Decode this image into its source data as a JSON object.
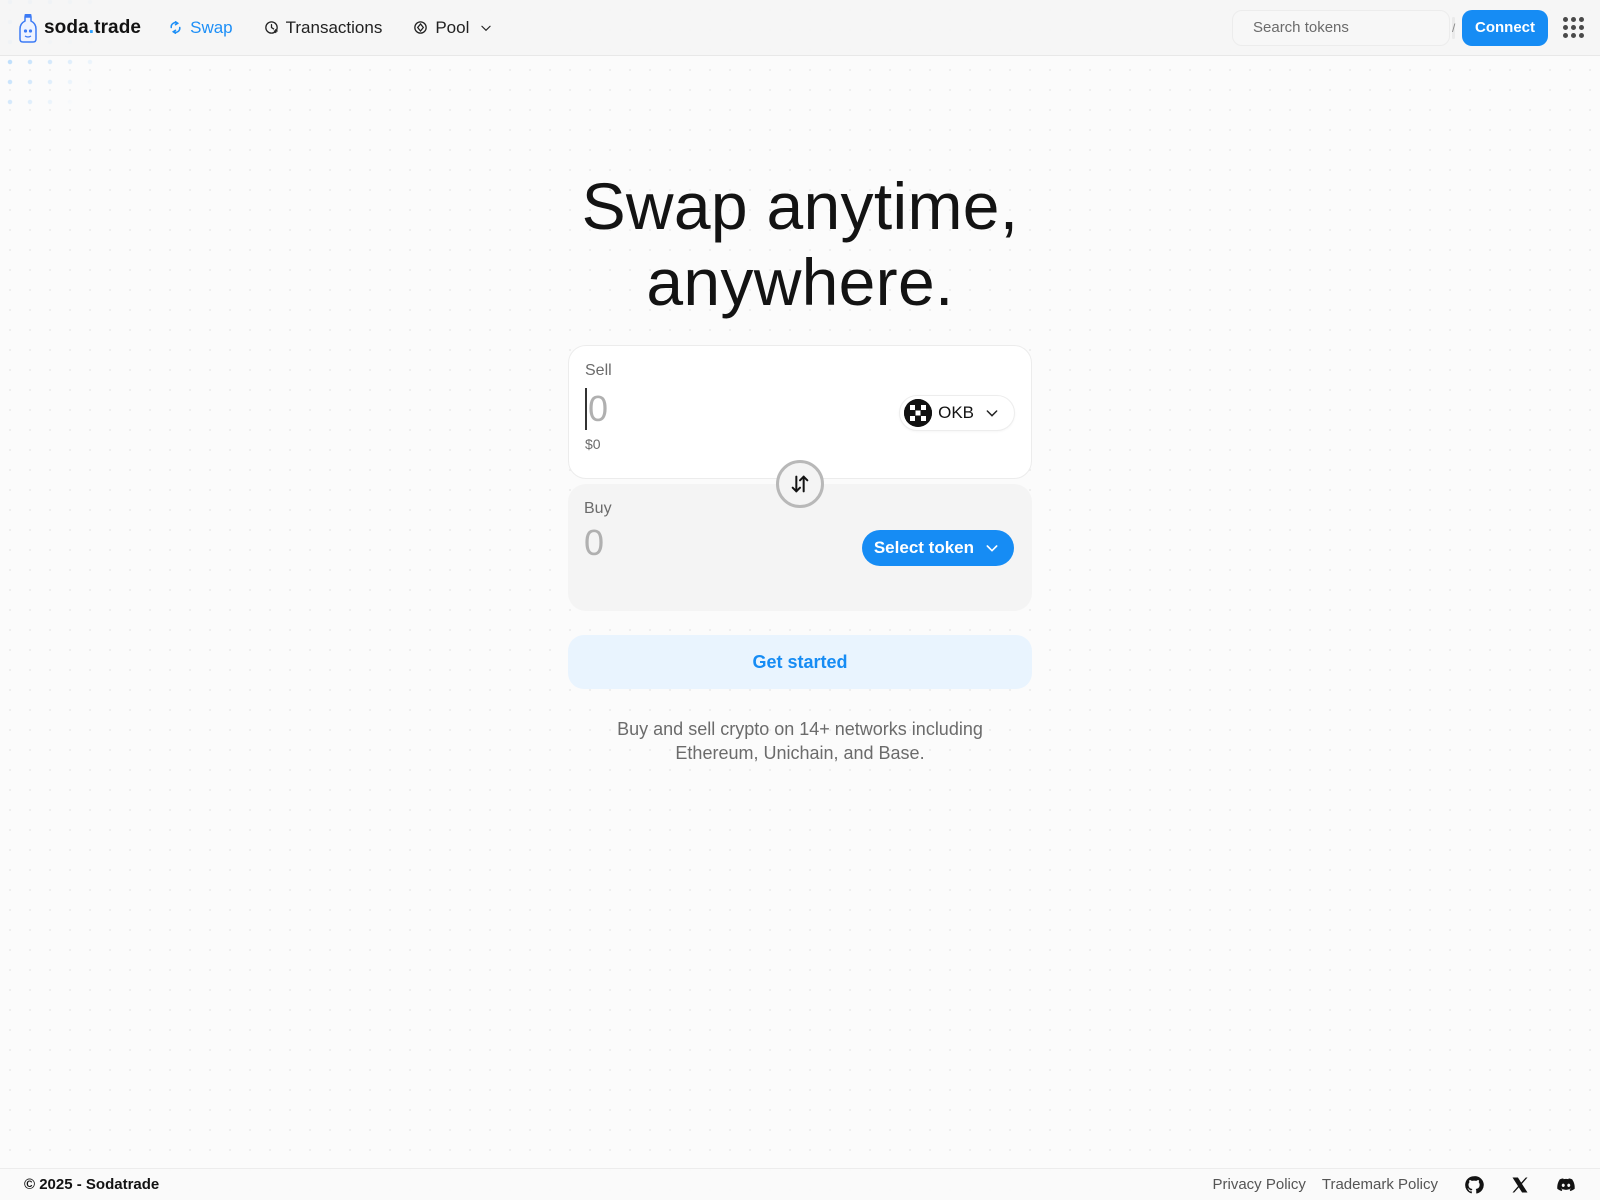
{
  "brand": {
    "name_prefix": "soda",
    "name_dot": ".",
    "name_suffix": "trade"
  },
  "nav": {
    "items": [
      {
        "label": "Swap",
        "icon": "swap-icon",
        "active": true
      },
      {
        "label": "Transactions",
        "icon": "transactions-icon",
        "active": false
      },
      {
        "label": "Pool",
        "icon": "pool-icon",
        "active": false
      }
    ]
  },
  "search": {
    "placeholder": "Search tokens",
    "shortcut": "/"
  },
  "header": {
    "connect_label": "Connect"
  },
  "hero": {
    "line1": "Swap anytime,",
    "line2": "anywhere."
  },
  "sell": {
    "label": "Sell",
    "amount": "0",
    "usd_value": "$0",
    "token": "OKB"
  },
  "buy": {
    "label": "Buy",
    "amount": "0",
    "select_label": "Select token"
  },
  "cta": {
    "label": "Get started"
  },
  "tagline": {
    "line1": "Buy and sell crypto on 14+ networks including",
    "line2": "Ethereum, Unichain, and Base."
  },
  "footer": {
    "copyright": "© 2025 - Sodatrade",
    "links": [
      "Privacy Policy",
      "Trademark Policy"
    ],
    "social": [
      "github-icon",
      "x-icon",
      "discord-icon"
    ]
  },
  "colors": {
    "accent": "#168cf4",
    "accent_light": "#e9f4fe",
    "text": "#131313",
    "muted": "#6b6b6b"
  }
}
